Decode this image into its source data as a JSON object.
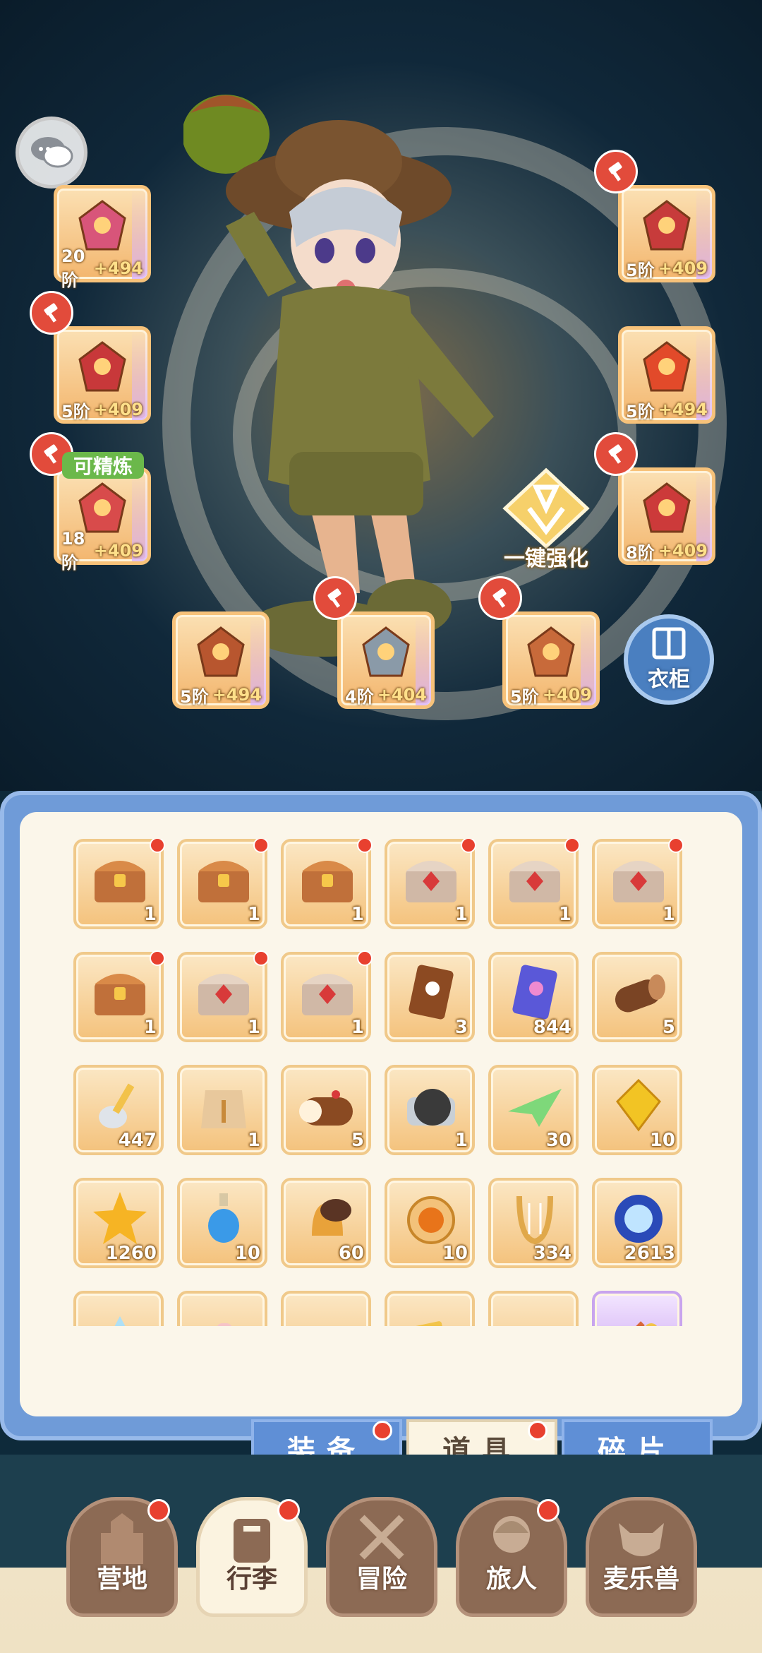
{
  "colors": {
    "accent_blue": "#5f8fd6",
    "badge_red": "#e8402f",
    "refine_green": "#6bb84a",
    "gold": "#f4c27c"
  },
  "equipment": [
    {
      "id": "weapon",
      "tier": "20阶",
      "bonus": "+494",
      "hammer": false
    },
    {
      "id": "armor",
      "tier": "5阶",
      "bonus": "+409",
      "hammer": true
    },
    {
      "id": "chest",
      "tier": "18阶",
      "bonus": "+409",
      "hammer": true
    },
    {
      "id": "helmet",
      "tier": "5阶",
      "bonus": "+409",
      "hammer": true
    },
    {
      "id": "gauntlet",
      "tier": "5阶",
      "bonus": "+494",
      "hammer": false
    },
    {
      "id": "boots",
      "tier": "8阶",
      "bonus": "+409",
      "hammer": true
    },
    {
      "id": "ring",
      "tier": "5阶",
      "bonus": "+494",
      "hammer": false
    },
    {
      "id": "necklace",
      "tier": "4阶",
      "bonus": "+404",
      "hammer": true
    },
    {
      "id": "charm",
      "tier": "5阶",
      "bonus": "+409",
      "hammer": true
    }
  ],
  "refine_label": "可精炼",
  "enhance_label": "一键强化",
  "wardrobe_label": "衣柜",
  "items": [
    {
      "icon": "gold-chest-icon",
      "count": "1",
      "new": true
    },
    {
      "icon": "gold-chest-icon",
      "count": "1",
      "new": true
    },
    {
      "icon": "gold-chest-icon",
      "count": "1",
      "new": true
    },
    {
      "icon": "silver-chest-icon",
      "count": "1",
      "new": true
    },
    {
      "icon": "silver-chest-icon",
      "count": "1",
      "new": true
    },
    {
      "icon": "silver-chest-icon",
      "count": "1",
      "new": true
    },
    {
      "icon": "gold-chest-icon",
      "count": "1",
      "new": true
    },
    {
      "icon": "silver-chest-icon",
      "count": "1",
      "new": true
    },
    {
      "icon": "silver-chest-icon",
      "count": "1",
      "new": true
    },
    {
      "icon": "brown-ticket-icon",
      "count": "3",
      "new": false
    },
    {
      "icon": "blue-ticket-icon",
      "count": "844",
      "new": false
    },
    {
      "icon": "log-icon",
      "count": "5",
      "new": false
    },
    {
      "icon": "spoon-icon",
      "count": "447",
      "new": false
    },
    {
      "icon": "wheat-bag-icon",
      "count": "1",
      "new": false
    },
    {
      "icon": "cake-roll-icon",
      "count": "5",
      "new": false
    },
    {
      "icon": "machine-icon",
      "count": "1",
      "new": false
    },
    {
      "icon": "paper-plane-icon",
      "count": "30",
      "new": false
    },
    {
      "icon": "yellow-gem-icon",
      "count": "10",
      "new": false
    },
    {
      "icon": "star-crystal-icon",
      "count": "1260",
      "new": false
    },
    {
      "icon": "blue-potion-icon",
      "count": "10",
      "new": false
    },
    {
      "icon": "bell-icon",
      "count": "60",
      "new": false
    },
    {
      "icon": "cat-orb-icon",
      "count": "10",
      "new": false
    },
    {
      "icon": "lyre-icon",
      "count": "334",
      "new": false
    },
    {
      "icon": "blue-orb-icon",
      "count": "2613",
      "new": false
    },
    {
      "icon": "ice-crystal-icon",
      "count": "",
      "new": false
    },
    {
      "icon": "bottle-icon",
      "count": "",
      "new": false
    },
    {
      "icon": "flower-icon",
      "count": "",
      "new": false
    },
    {
      "icon": "gold-card-icon",
      "count": "",
      "new": false
    },
    {
      "icon": "bow-icon",
      "count": "",
      "new": false
    },
    {
      "icon": "purple-item-icon",
      "count": "",
      "new": false
    }
  ],
  "tabs": [
    {
      "label": "装备",
      "active": false,
      "new": true
    },
    {
      "label": "道具",
      "active": true,
      "new": true
    },
    {
      "label": "碎片",
      "active": false,
      "new": false
    }
  ],
  "nav": [
    {
      "label": "营地",
      "icon": "castle-icon",
      "active": false,
      "new": true
    },
    {
      "label": "行李",
      "icon": "backpack-icon",
      "active": true,
      "new": true
    },
    {
      "label": "冒险",
      "icon": "crossed-swords-icon",
      "active": false,
      "new": false
    },
    {
      "label": "旅人",
      "icon": "character-icon",
      "active": false,
      "new": true
    },
    {
      "label": "麦乐兽",
      "icon": "fox-icon",
      "active": false,
      "new": false
    }
  ]
}
